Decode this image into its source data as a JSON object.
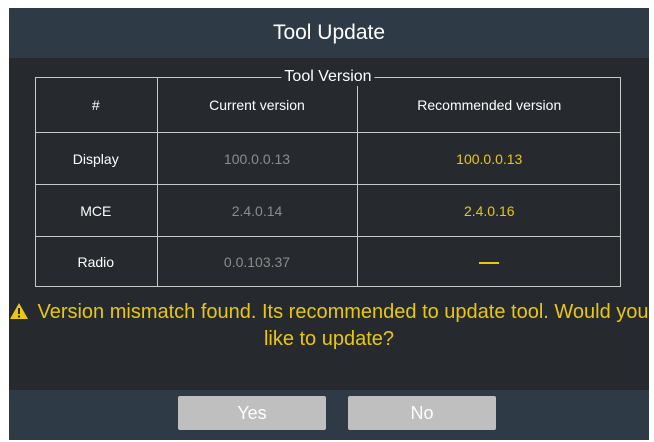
{
  "dialog": {
    "title": "Tool Update",
    "section_title": "Tool Version"
  },
  "table": {
    "headers": [
      "#",
      "Current version",
      "Recommended version"
    ],
    "rows": [
      {
        "name": "Display",
        "current": "100.0.0.13",
        "recommended": "100.0.0.13"
      },
      {
        "name": "MCE",
        "current": "2.4.0.14",
        "recommended": "2.4.0.16"
      },
      {
        "name": "Radio",
        "current": "0.0.103.37",
        "recommended": "—"
      }
    ]
  },
  "message": {
    "icon": "warning-icon",
    "text": "Version mismatch found. Its recommended to update tool. Would you like to update?"
  },
  "buttons": {
    "yes_label": "Yes",
    "no_label": "No"
  },
  "colors": {
    "dialog_bg": "#262a2f",
    "bar_bg": "#2f3a47",
    "accent_yellow": "#e8c80c",
    "muted_text": "#8c8c8c",
    "button_bg": "#bfbfbf"
  }
}
